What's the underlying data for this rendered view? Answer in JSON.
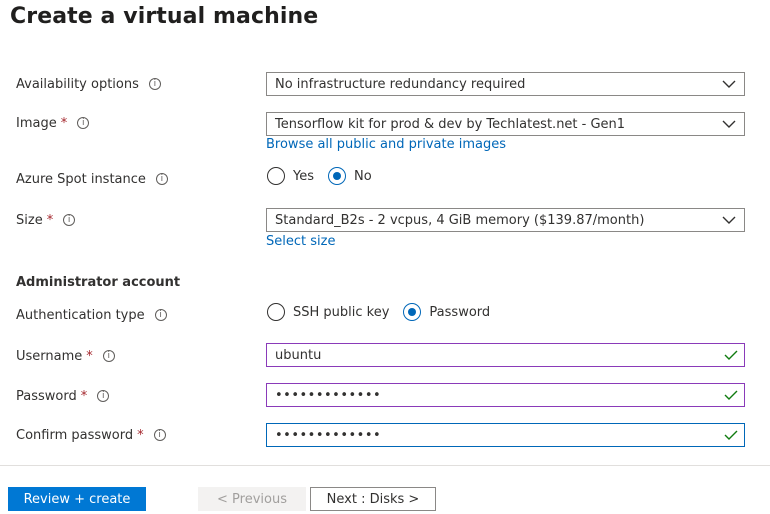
{
  "page": {
    "title": "Create a virtual machine"
  },
  "fields": {
    "availability": {
      "label": "Availability options",
      "value": "No infrastructure redundancy required"
    },
    "image": {
      "label": "Image",
      "required": "*",
      "value": "Tensorflow kit for prod & dev by Techlatest.net - Gen1",
      "link": "Browse all public and private images"
    },
    "spot": {
      "label": "Azure Spot instance",
      "options": [
        "Yes",
        "No"
      ],
      "selected": "No"
    },
    "size": {
      "label": "Size",
      "required": "*",
      "value": "Standard_B2s - 2 vcpus, 4 GiB memory ($139.87/month)",
      "link": "Select size"
    },
    "admin_section": "Administrator account",
    "auth_type": {
      "label": "Authentication type",
      "options": [
        "SSH public key",
        "Password"
      ],
      "selected": "Password"
    },
    "username": {
      "label": "Username",
      "required": "*",
      "value": "ubuntu"
    },
    "password": {
      "label": "Password",
      "required": "*",
      "value": "•••••••••••••"
    },
    "confirm_password": {
      "label": "Confirm password",
      "required": "*",
      "value": "•••••••••••••"
    }
  },
  "info_glyph": "i",
  "footer": {
    "review_create": "Review + create",
    "previous": "< Previous",
    "next": "Next : Disks >"
  },
  "colors": {
    "accent": "#0078d4",
    "link": "#0067b8",
    "required": "#a4262c",
    "valid_check": "#107c10",
    "input_border": "#8a3ab9"
  },
  "icons": {
    "info": "info-icon",
    "dropdown": "chevron-down-icon",
    "valid": "checkmark-icon"
  }
}
